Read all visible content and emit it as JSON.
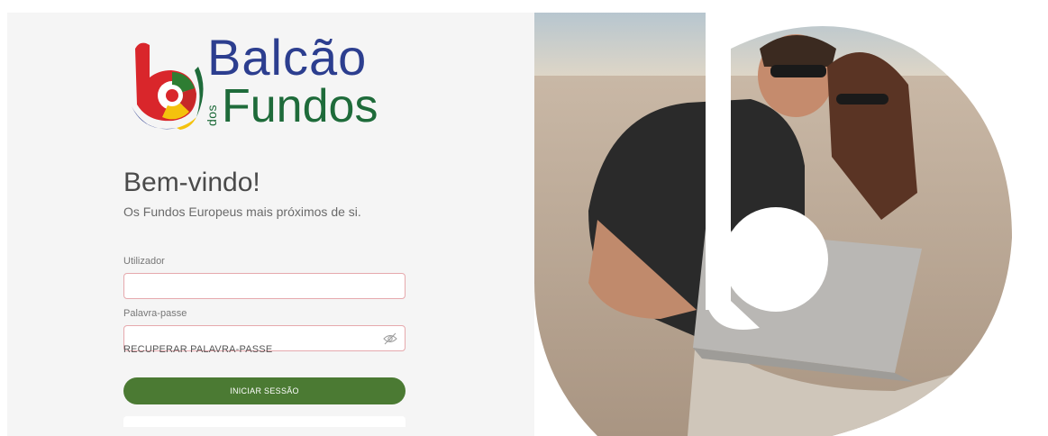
{
  "logo": {
    "line1": "Balcão",
    "dos": "dos",
    "line2": "Fundos"
  },
  "welcome": {
    "title": "Bem-vindo!",
    "subtitle": "Os Fundos Europeus mais próximos de si."
  },
  "form": {
    "username_label": "Utilizador",
    "username_value": "",
    "password_label": "Palavra-passe",
    "password_value": "",
    "recover_link": "RECUPERAR PALAVRA-PASSE",
    "submit_label": "INICIAR SESSÃO"
  },
  "colors": {
    "brand_blue": "#2c3e8f",
    "brand_green": "#1e6b3a",
    "button_green": "#4b7a33",
    "input_border": "#e6a9ad"
  }
}
